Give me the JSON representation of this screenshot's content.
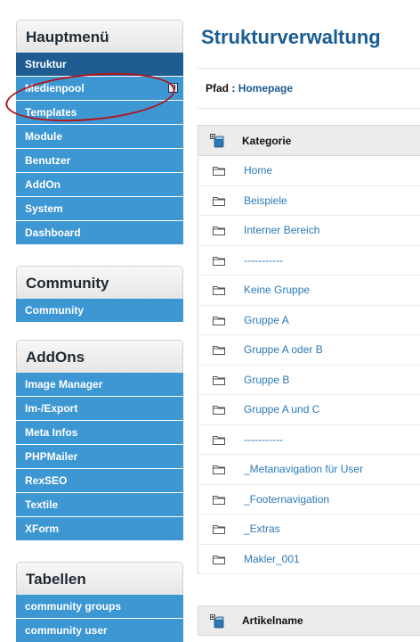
{
  "sidebar": {
    "main_menu": {
      "title": "Hauptmenü",
      "items": [
        {
          "label": "Struktur",
          "active": true
        },
        {
          "label": "Medienpool",
          "active": false,
          "icon": "external-window-icon"
        },
        {
          "label": "Templates",
          "active": false
        },
        {
          "label": "Module",
          "active": false
        },
        {
          "label": "Benutzer",
          "active": false
        },
        {
          "label": "AddOn",
          "active": false
        },
        {
          "label": "System",
          "active": false
        },
        {
          "label": "Dashboard",
          "active": false
        }
      ]
    },
    "community": {
      "title": "Community",
      "items": [
        {
          "label": "Community"
        }
      ]
    },
    "addons": {
      "title": "AddOns",
      "items": [
        {
          "label": "Image Manager"
        },
        {
          "label": "Im-/Export"
        },
        {
          "label": "Meta Infos"
        },
        {
          "label": "PHPMailer"
        },
        {
          "label": "RexSEO"
        },
        {
          "label": "Textile"
        },
        {
          "label": "XForm"
        }
      ]
    },
    "tables": {
      "title": "Tabellen",
      "items": [
        {
          "label": "community groups"
        },
        {
          "label": "community user"
        }
      ]
    }
  },
  "main": {
    "title": "Strukturverwaltung",
    "path_label": "Pfad :",
    "path_link": "Homepage",
    "category_header": "Kategorie",
    "categories": [
      "Home",
      "Beispiele",
      "Interner Bereich",
      "-----------",
      "Keine Gruppe",
      "Gruppe A",
      "Gruppe A oder B",
      "Gruppe B",
      "Gruppe A und C",
      "-----------",
      "_Metanavigation für User",
      "_Footernavigation",
      "_Extras",
      "Makler_001"
    ],
    "article_header": "Artikelname"
  },
  "colors": {
    "menu_item": "#3d97d3",
    "menu_item_active": "#1f5c91",
    "title": "#1b5c93",
    "link": "#2b79b6",
    "annotation_circle": "#b3141b"
  }
}
